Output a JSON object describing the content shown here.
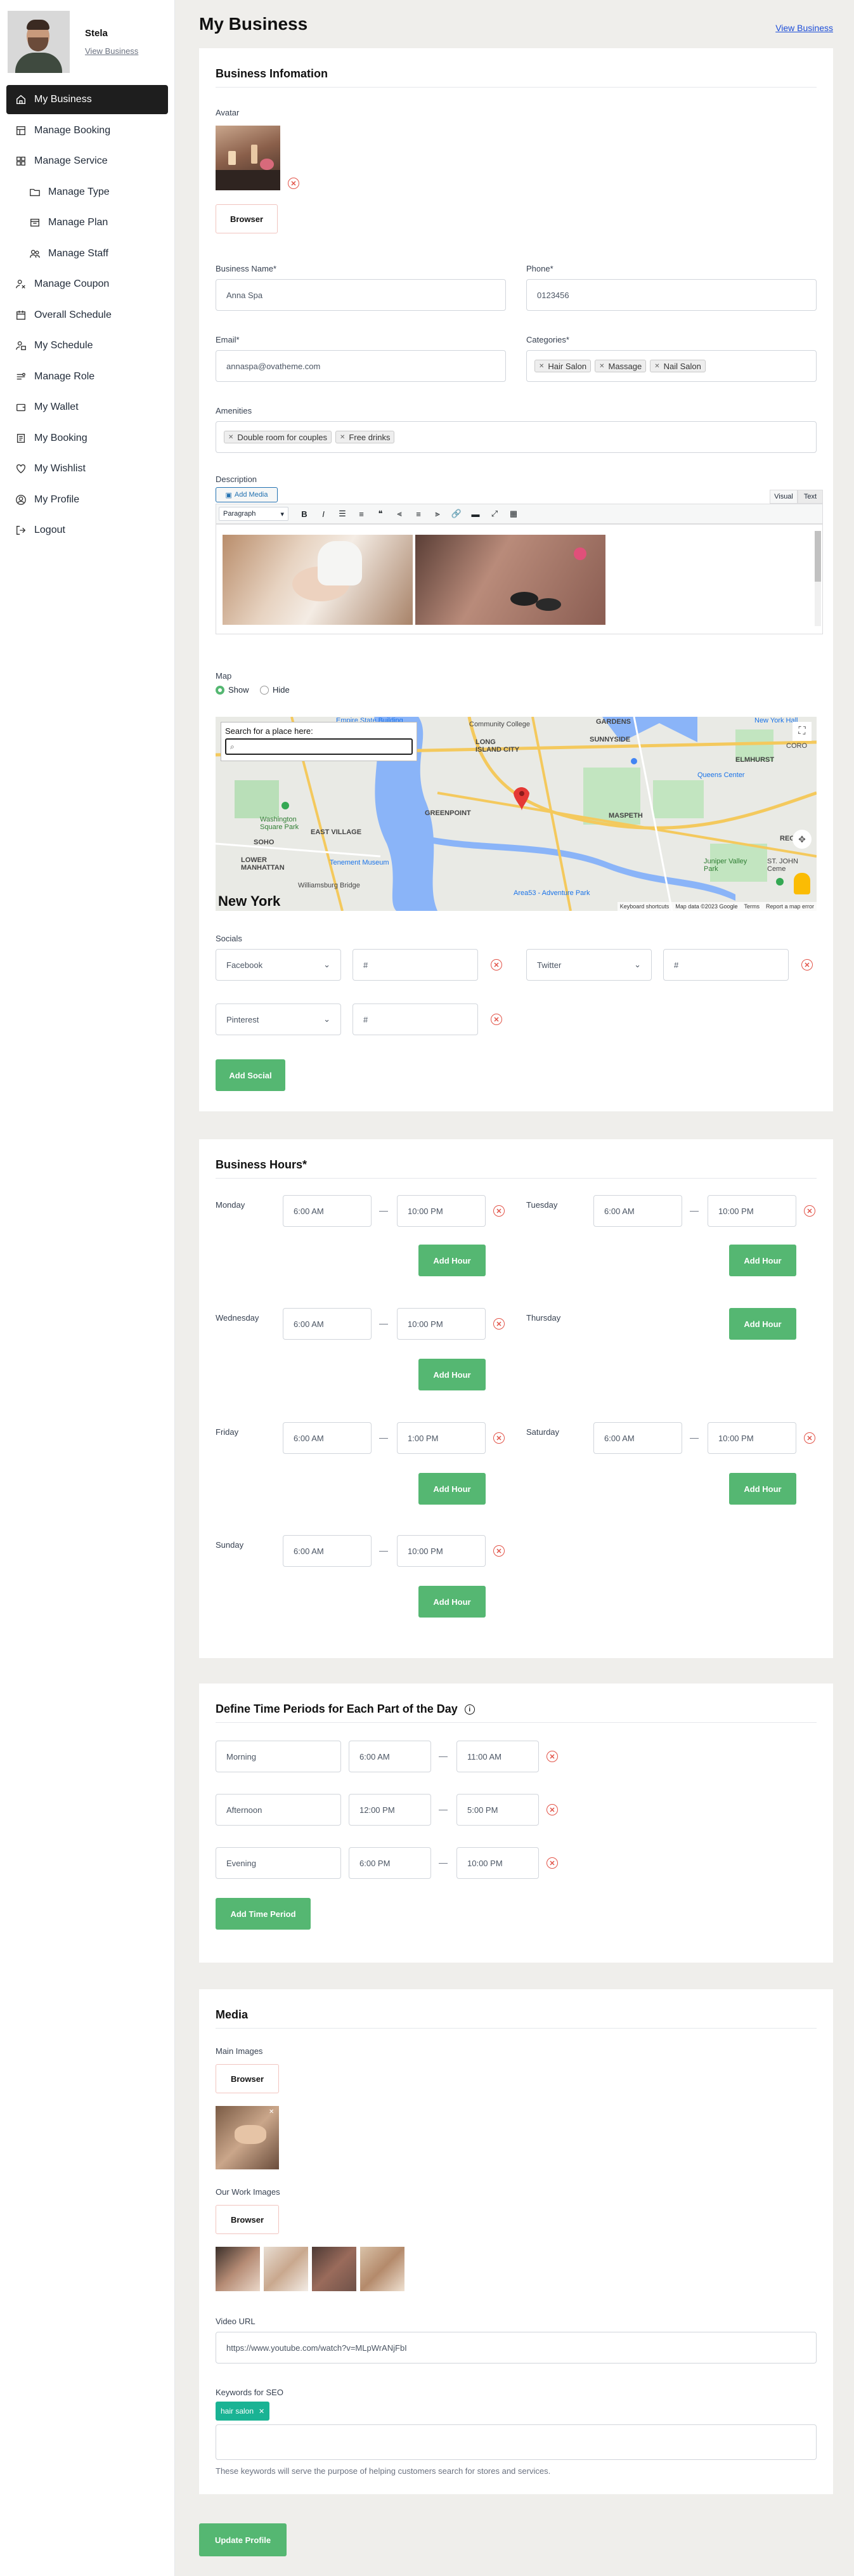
{
  "profile": {
    "name": "Stela",
    "view_business": "View Business"
  },
  "nav": [
    {
      "label": "My Business",
      "icon": "home-icon"
    },
    {
      "label": "Manage Booking",
      "icon": "booking-icon"
    },
    {
      "label": "Manage Service",
      "icon": "grid-icon"
    },
    {
      "label": "Manage Type",
      "icon": "folder-icon"
    },
    {
      "label": "Manage Plan",
      "icon": "plan-icon"
    },
    {
      "label": "Manage Staff",
      "icon": "staff-icon"
    },
    {
      "label": "Manage Coupon",
      "icon": "coupon-icon"
    },
    {
      "label": "Overall Schedule",
      "icon": "schedule-icon"
    },
    {
      "label": "My Schedule",
      "icon": "calendar-user-icon"
    },
    {
      "label": "Manage Role",
      "icon": "role-icon"
    },
    {
      "label": "My Wallet",
      "icon": "wallet-icon"
    },
    {
      "label": "My Booking",
      "icon": "list-icon"
    },
    {
      "label": "My Wishlist",
      "icon": "heart-icon"
    },
    {
      "label": "My Profile",
      "icon": "user-circle-icon"
    },
    {
      "label": "Logout",
      "icon": "logout-icon"
    }
  ],
  "header": {
    "title": "My Business",
    "view_business": "View Business"
  },
  "business_info": {
    "title": "Business Infomation",
    "avatar_label": "Avatar",
    "browser_label": "Browser",
    "business_name_label": "Business Name*",
    "business_name_value": "Anna Spa",
    "phone_label": "Phone*",
    "phone_value": "0123456",
    "email_label": "Email*",
    "email_value": "annaspa@ovatheme.com",
    "categories_label": "Categories*",
    "categories": [
      "Hair Salon",
      "Massage",
      "Nail Salon"
    ],
    "amenities_label": "Amenities",
    "amenities": [
      "Double room for couples",
      "Free drinks"
    ],
    "description_label": "Description",
    "add_media": "Add Media",
    "visual_tab": "Visual",
    "text_tab": "Text",
    "paragraph_select": "Paragraph",
    "map_label": "Map",
    "map_show": "Show",
    "map_hide": "Hide",
    "map_search_label": "Search for a place here:",
    "map_places": [
      "Empire State Building",
      "Community College",
      "LONG ISLAND CITY",
      "SUNNYSIDE",
      "GARDENS",
      "New York Hall",
      "ELMHURST",
      "Queens Center",
      "CORO",
      "Washington Square Park",
      "EAST VILLAGE",
      "GREENPOINT",
      "MASPETH",
      "SOHO",
      "LOWER MANHATTAN",
      "Tenement Museum",
      "Williamsburg Bridge",
      "Area53 - Adventure Park",
      "Juniper Valley Park",
      "REGO",
      "ST. JOHN Ceme",
      "New York"
    ],
    "map_footer": [
      "Keyboard shortcuts",
      "Map data ©2023 Google",
      "Terms",
      "Report a map error"
    ],
    "socials_label": "Socials",
    "socials": [
      {
        "network": "Facebook",
        "value": "#"
      },
      {
        "network": "Twitter",
        "value": "#"
      },
      {
        "network": "Pinterest",
        "value": "#"
      }
    ],
    "add_social": "Add Social"
  },
  "business_hours": {
    "title": "Business Hours*",
    "days": [
      {
        "day": "Monday",
        "slots": [
          {
            "start": "6:00 AM",
            "end": "10:00 PM"
          }
        ]
      },
      {
        "day": "Tuesday",
        "slots": [
          {
            "start": "6:00 AM",
            "end": "10:00 PM"
          }
        ]
      },
      {
        "day": "Wednesday",
        "slots": [
          {
            "start": "6:00 AM",
            "end": "10:00 PM"
          }
        ]
      },
      {
        "day": "Thursday",
        "slots": []
      },
      {
        "day": "Friday",
        "slots": [
          {
            "start": "6:00 AM",
            "end": "1:00 PM"
          }
        ]
      },
      {
        "day": "Saturday",
        "slots": [
          {
            "start": "6:00 AM",
            "end": "10:00 PM"
          }
        ]
      },
      {
        "day": "Sunday",
        "slots": [
          {
            "start": "6:00 AM",
            "end": "10:00 PM"
          }
        ]
      }
    ],
    "add_hour": "Add Hour",
    "dash": "—"
  },
  "time_periods": {
    "title": "Define Time Periods for Each Part of the Day",
    "periods": [
      {
        "name": "Morning",
        "start": "6:00 AM",
        "end": "11:00 AM"
      },
      {
        "name": "Afternoon",
        "start": "12:00 PM",
        "end": "5:00 PM"
      },
      {
        "name": "Evening",
        "start": "6:00 PM",
        "end": "10:00 PM"
      }
    ],
    "add_time_period": "Add Time Period"
  },
  "media": {
    "title": "Media",
    "main_images_label": "Main Images",
    "our_work_label": "Our Work Images",
    "browser_label": "Browser",
    "video_url_label": "Video URL",
    "video_url_value": "https://www.youtube.com/watch?v=MLpWrANjFbI",
    "keywords_label": "Keywords for SEO",
    "keyword_tag": "hair salon",
    "keywords_help": "These keywords will serve the purpose of helping customers search for stores and services."
  },
  "update_profile": "Update Profile"
}
